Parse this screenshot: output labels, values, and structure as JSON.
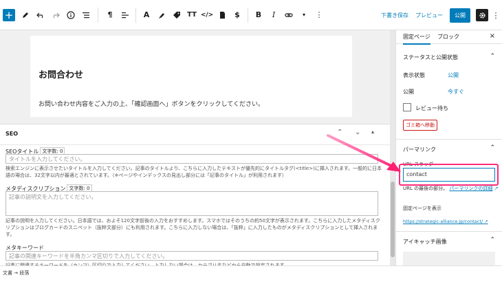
{
  "toolbar": {
    "left_icons": [
      "add-icon",
      "pencil-icon",
      "undo-icon",
      "redo-icon",
      "info-icon",
      "list-view-icon"
    ],
    "format_icons": [
      "paragraph-icon",
      "align-icon",
      "font-icon",
      "marker-icon",
      "tag-icon",
      "text-size-icon",
      "code-icon",
      "document-icon",
      "dollar-icon",
      "bold-icon",
      "italic-icon",
      "link-icon",
      "chevron-down-icon",
      "more-icon"
    ],
    "save_draft": "下書き保存",
    "preview": "プレビュー",
    "publish": "公開"
  },
  "content": {
    "heading": "お問合わせ",
    "paragraph": "お問い合わせ内容をご入力の上、「確認画面へ」ボタンをクリックしてください。"
  },
  "seo": {
    "title": "SEO",
    "seo_title_label": "SEOタイトル",
    "seo_title_count": "文字数: 0",
    "seo_title_placeholder": "タイトルを入力してください。",
    "seo_title_help": "検索エンジンに表示させたいタイトルを入力してください。記事のタイトルより、こちらに入力したテキストが優先的にタイトルタグ(<title>)に挿入されます。一般的に日本語の場合は、32文字以内が最適とされています。（※ページやインデックスの見出し部分には「記事のタイトル」が利用されます）",
    "meta_desc_label": "メタディスクリプション",
    "meta_desc_count": "文字数: 0",
    "meta_desc_placeholder": "記事の説明文を入力してください。",
    "meta_desc_help": "記事の説明を入力してください。日本語では、およそ120文字前後の入力をおすすめします。スマホではそのうちの約50文字が表示されます。こちらに入力したメタディスクリプションはブログカードのスニペット（抜粋文部分）にも利用されます。こちらに入力しない場合は、「抜粋」に入力したものがメタディスクリプションとして挿入されます。",
    "meta_kw_label": "メタキーワード",
    "meta_kw_placeholder": "記事の関連キーワードを半角カンマ区切りで入力してください。",
    "meta_kw_help": "記事に関連するキーワードを（カンマ）区切りで入力してください。入力しない場合は、カテゴリ名などから自動で設定されます。"
  },
  "sidebar": {
    "tab_page": "固定ページ",
    "tab_block": "ブロック",
    "status_title": "ステータスと公開状態",
    "visibility_label": "表示状態",
    "visibility_value": "公開",
    "publish_label": "公開",
    "publish_value": "今すぐ",
    "review_label": "レビュー待ち",
    "trash_label": "ゴミ箱へ移動",
    "permalink_title": "パーマリンク",
    "url_slug_label": "URL スラッグ",
    "url_slug_value": "contact",
    "url_last_part": "URL の最後の部分。",
    "permalink_link": "パーマリンクの詳細",
    "view_page": "固定ページを表示",
    "page_url": "https://strategic-alliance.jp/contact/",
    "featured_image": "アイキャッチ画像"
  },
  "status": {
    "breadcrumb": "文書 → 段落"
  },
  "colors": {
    "accent": "#007cba",
    "highlight": "#ff2a7a",
    "danger": "#cc1818"
  }
}
